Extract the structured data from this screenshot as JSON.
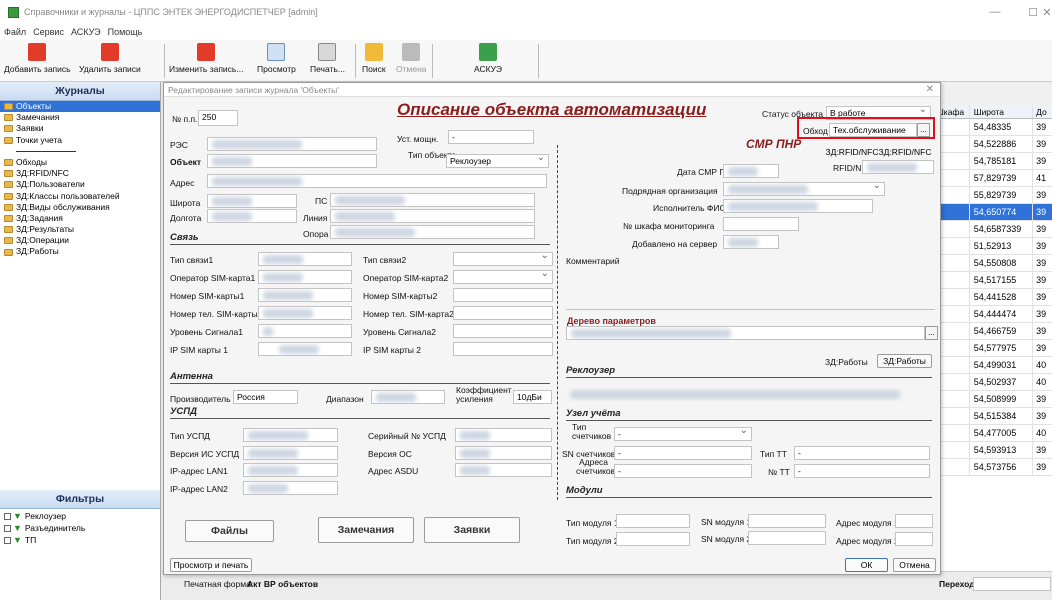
{
  "window": {
    "title": "Справочники и журналы - ЦППС ЭНТЕК ЭНЕРГОДИСПЕТЧЕР [admin]",
    "minimize": "—",
    "maximize": "☐",
    "close": "✕"
  },
  "menu": [
    "Файл",
    "Сервис",
    "АСКУЭ",
    "Помощь"
  ],
  "toolbar": {
    "add": "Добавить запись",
    "delete": "Удалить записи",
    "edit": "Изменить запись...",
    "view": "Просмотр",
    "print": "Печать...",
    "search": "Поиск",
    "cancel": "Отмена",
    "askue": "АСКУЭ"
  },
  "journals": {
    "title": "Журналы",
    "items": [
      "Объекты",
      "Замечания",
      "Заявки",
      "Точки учета",
      "",
      "Обходы",
      "ЗД:RFID/NFC",
      "ЗД:Пользователи",
      "ЗД:Классы пользователей",
      "ЗД:Виды обслуживания",
      "ЗД:Задания",
      "ЗД:Результаты",
      "ЗД:Операции",
      "ЗД:Работы"
    ],
    "selected_index": 0
  },
  "filters": {
    "title": "Фильтры",
    "items": [
      "Реклоузер",
      "Разъединитель",
      "ТП"
    ]
  },
  "grid": {
    "headers": [
      "Шкафа",
      "Широта",
      "До"
    ],
    "rows": [
      [
        "",
        "54,48335",
        "39"
      ],
      [
        "",
        "54,522886",
        "39"
      ],
      [
        "",
        "54,785181",
        "39"
      ],
      [
        "",
        "57,829739",
        "41"
      ],
      [
        "",
        "55,829739",
        "39"
      ],
      [
        "",
        "54,650774",
        "39"
      ],
      [
        "",
        "54,6587339",
        "39"
      ],
      [
        "",
        "51,52913",
        "39"
      ],
      [
        "",
        "54,550808",
        "39"
      ],
      [
        "",
        "54,517155",
        "39"
      ],
      [
        "",
        "54,441528",
        "39"
      ],
      [
        "",
        "54,444474",
        "39"
      ],
      [
        "",
        "54,466759",
        "39"
      ],
      [
        "",
        "54,577975",
        "39"
      ],
      [
        "",
        "54,499031",
        "40"
      ],
      [
        "",
        "54,502937",
        "40"
      ],
      [
        "",
        "54,508999",
        "39"
      ],
      [
        "",
        "54,515384",
        "39"
      ],
      [
        "",
        "54,477005",
        "40"
      ],
      [
        "",
        "54,593913",
        "39"
      ],
      [
        "",
        "54,573756",
        "39"
      ]
    ],
    "selected_index": 5
  },
  "statusbar": {
    "print_form_label": "Печатная форма:",
    "print_form_value": "Акт ВР объектов",
    "goto_label": "Переход к"
  },
  "dialog": {
    "title": "Редактирование записи журнала 'Объекты'",
    "heading": "Описание объекта автоматизации",
    "num_label": "№ п.п.",
    "num_value": "250",
    "status_label": "Статус объекта",
    "status_value": "В работе",
    "obhod_label": "Обход",
    "obhod_value": "Тех.обслуживание",
    "res_label": "РЭС",
    "ust_label": "Уст. мощн.",
    "ust_value": "-",
    "object_label": "Объект",
    "type_label": "Тип объекта",
    "type_value": "Реклоузер",
    "address_label": "Адрес",
    "lat_label": "Широта",
    "ps_label": "ПС",
    "lon_label": "Долгота",
    "line_label": "Линия",
    "opora_label": "Опора",
    "smr_heading": "СМР ПНР",
    "rfid_btn": "ЗД:RFID/NFC",
    "rfid_btn2": "ЗД:RFID/NFC",
    "rfid_label": "RFID/NFC",
    "smr_date_label": "Дата СМР ПНР",
    "contractor_label": "Подрядная организация",
    "executor_label": "Исполнитель ФИО",
    "cabinet_label": "№ шкафа мониторинга",
    "added_label": "Добавлено на сервер",
    "comment_label": "Комментарий",
    "params_label": "Дерево параметров",
    "works_btn": "ЗД:Работы",
    "works_btn2": "ЗД:Работы",
    "link_heading": "Связь",
    "link_type1": "Тип связи1",
    "link_type2": "Тип связи2",
    "sim_op1": "Оператор SIM-карта1",
    "sim_op2": "Оператор SIM-карта2",
    "sim_num1": "Номер SIM-карты1",
    "sim_num2": "Номер SIM-карты2",
    "sim_tel1": "Номер тел. SIM-карты1",
    "sim_tel2": "Номер тел. SIM-карта2",
    "signal1": "Уровень Сигнала1",
    "signal2": "Уровень Сигнала2",
    "ip1": "IP SIM карты 1",
    "ip2": "IP SIM карты 2",
    "antenna_heading": "Антенна",
    "manufacturer_label": "Производитель",
    "manufacturer_value": "Россия",
    "range_label": "Диапазон",
    "gain_label": "Коэффициент усиления",
    "gain_value": "10дБи",
    "uspd_heading": "УСПД",
    "uspd_type": "Тип УСПД",
    "uspd_serial": "Серийный № УСПД",
    "uspd_is": "Версия ИС УСПД",
    "uspd_os": "Версия ОС",
    "ip_lan1": "IP-адрес LAN1",
    "asdu": "Адрес ASDU",
    "ip_lan2": "IP-адрес LAN2",
    "recloser_heading": "Реклоузер",
    "meter_heading": "Узел учёта",
    "meter_type": "Тип счетчиков",
    "meter_type_value": "-",
    "sn_label": "SN счетчиков",
    "sn_value": "-",
    "tt_type": "Тип ТТ",
    "tt_type_value": "-",
    "tt_num": "№ ТТ",
    "tt_num_value": "-",
    "meter_addr": "Адреса счетчиков",
    "meter_addr_value": "-",
    "modules_heading": "Модули",
    "mod_type1": "Тип модуля 1",
    "mod_sn1": "SN модуля 1",
    "mod_addr1": "Адрес модуля 1",
    "mod_type2": "Тип модуля 2",
    "mod_sn2": "SN модуля 2",
    "mod_addr2": "Адрес модуля 2",
    "files_btn": "Файлы",
    "remarks_btn": "Замечания",
    "requests_btn": "Заявки",
    "print_btn": "Просмотр и печать",
    "ok_btn": "ОК",
    "cancel_btn": "Отмена",
    "dots": "..."
  },
  "colors": {
    "selection": "#2f72d8",
    "heading_red": "#8b1d1d",
    "highlight_box": "#e0101a"
  }
}
